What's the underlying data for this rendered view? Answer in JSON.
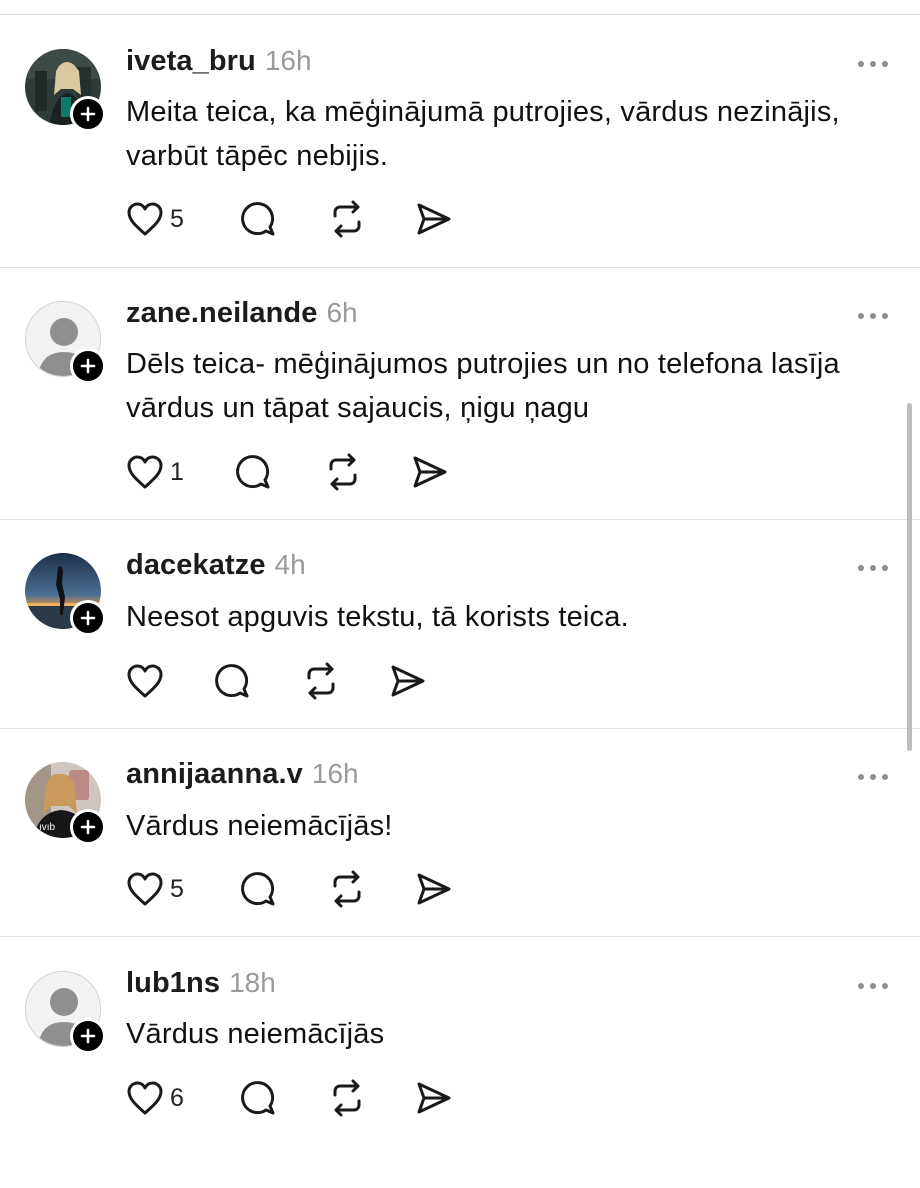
{
  "posts": [
    {
      "username": "iveta_bru",
      "time": "16h",
      "text": "Meita teica, ka mēģinājumā putrojies, vārdus nezinājis, varbūt tāpēc nebijis.",
      "likes": "5",
      "avatar": "photo-woman-icon"
    },
    {
      "username": "zane.neilande",
      "time": "6h",
      "text": "Dēls teica- mēģinājumos putrojies un no telefona lasīja vārdus un tāpat sajaucis, ņigu ņagu",
      "likes": "1",
      "avatar": "default-avatar-icon"
    },
    {
      "username": "dacekatze",
      "time": "4h",
      "text": "Neesot apguvis tekstu, tā korists teica.",
      "likes": "",
      "avatar": "sunset-photo-icon"
    },
    {
      "username": "annijaanna.v",
      "time": "16h",
      "text": "Vārdus neiemācījās!",
      "likes": "5",
      "avatar": "selfie-photo-icon"
    },
    {
      "username": "lub1ns",
      "time": "18h",
      "text": "Vārdus neiemācījās",
      "likes": "6",
      "avatar": "default-avatar-icon"
    }
  ],
  "colors": {
    "divider": "#e3e3e3",
    "muted": "#9a9a9a",
    "text": "#111111"
  }
}
